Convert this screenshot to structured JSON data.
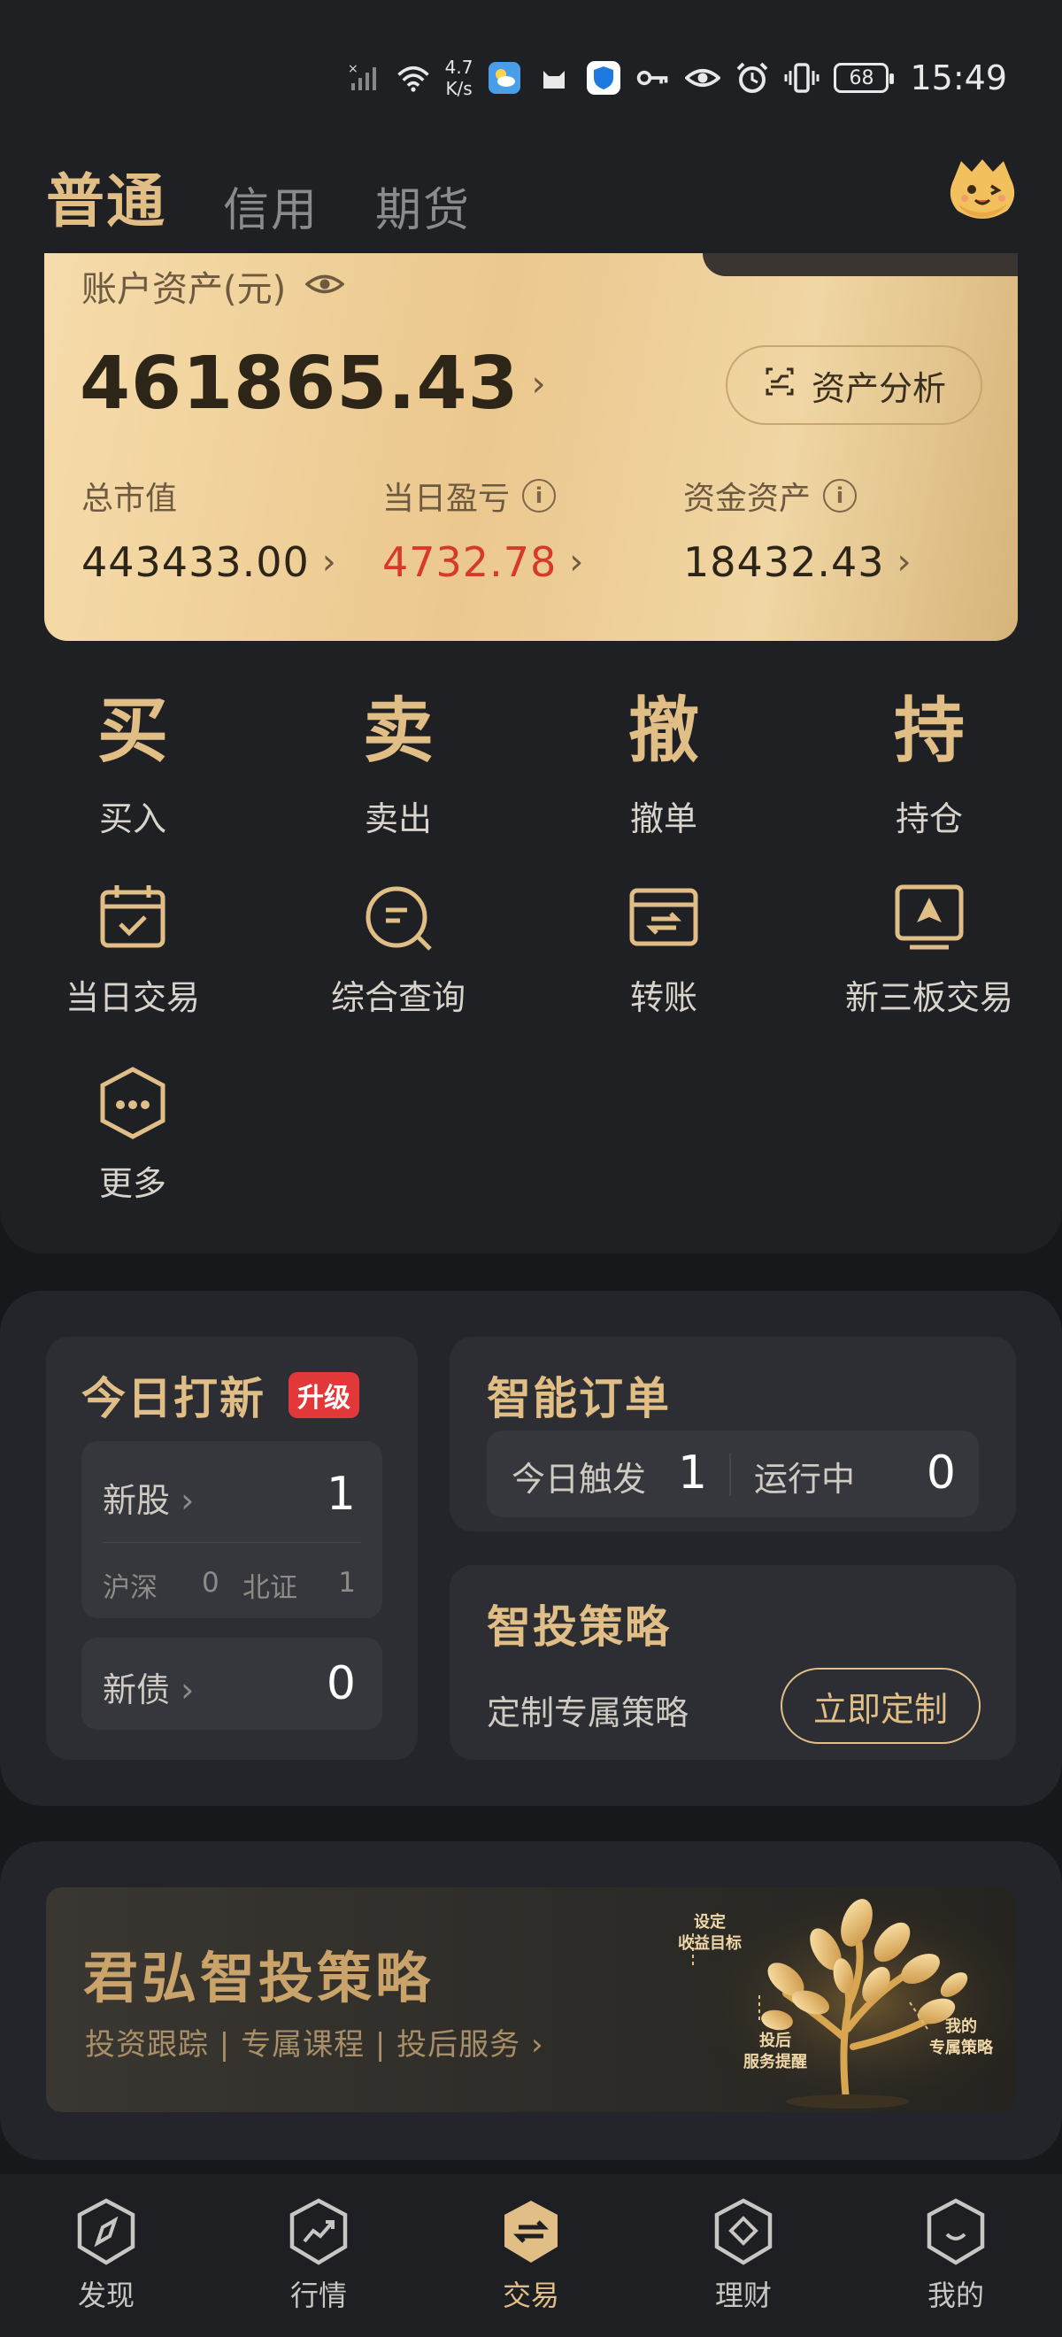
{
  "status_bar": {
    "speed_value": "4.7",
    "speed_unit": "K/s",
    "battery": "68",
    "time": "15:49"
  },
  "tabs": [
    {
      "label": "普通",
      "active": true
    },
    {
      "label": "信用",
      "active": false
    },
    {
      "label": "期货",
      "active": false
    }
  ],
  "asset_card": {
    "title": "账户资产(元)",
    "total": "461865.43",
    "analysis_button": "资产分析",
    "metrics": [
      {
        "label": "总市值",
        "value": "443433.00"
      },
      {
        "label": "当日盈亏",
        "value": "4732.78"
      },
      {
        "label": "资金资产",
        "value": "18432.43"
      }
    ]
  },
  "trade_actions": [
    {
      "glyph": "买",
      "label": "买入"
    },
    {
      "glyph": "卖",
      "label": "卖出"
    },
    {
      "glyph": "撤",
      "label": "撤单"
    },
    {
      "glyph": "持",
      "label": "持仓"
    }
  ],
  "tools": [
    {
      "label": "当日交易",
      "icon": "calendar-check-icon"
    },
    {
      "label": "综合查询",
      "icon": "search-list-icon"
    },
    {
      "label": "转账",
      "icon": "transfer-icon"
    },
    {
      "label": "新三板交易",
      "icon": "board-trade-icon"
    },
    {
      "label": "更多",
      "icon": "more-hexagon-icon"
    }
  ],
  "ipo_panel": {
    "title": "今日打新",
    "badge": "升级",
    "stock_label": "新股",
    "stock_count": "1",
    "shsz_label": "沪深",
    "shsz_count": "0",
    "bj_label": "北证",
    "bj_count": "1",
    "bond_label": "新债",
    "bond_count": "0"
  },
  "smart_order": {
    "title": "智能订单",
    "triggered_label": "今日触发",
    "triggered_count": "1",
    "running_label": "运行中",
    "running_count": "0"
  },
  "smart_strategy": {
    "title": "智投策略",
    "subtitle": "定制专属策略",
    "button": "立即定制"
  },
  "banner": {
    "title": "君弘智投策略",
    "subtitle": "投资跟踪 | 专属课程 | 投后服务 ›",
    "tree_labels": [
      "设定\n收益目标",
      "投后\n服务提醒",
      "我的\n专属策略"
    ]
  },
  "bottom_nav": [
    {
      "label": "发现",
      "icon": "compass-icon",
      "active": false
    },
    {
      "label": "行情",
      "icon": "trend-icon",
      "active": false
    },
    {
      "label": "交易",
      "icon": "exchange-icon",
      "active": true
    },
    {
      "label": "理财",
      "icon": "diamond-icon",
      "active": false
    },
    {
      "label": "我的",
      "icon": "smile-icon",
      "active": false
    }
  ],
  "colors": {
    "accent_gold": "#e0be86",
    "loss_gain_red": "#d83a2a",
    "background": "#1f2024"
  }
}
